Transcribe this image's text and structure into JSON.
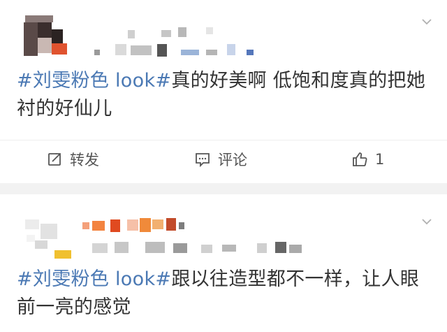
{
  "posts": [
    {
      "text_topic": "#刘雯粉色 look#",
      "text_body_line1": "真的好美啊 低饱和度真的把她",
      "text_body_line2": "衬的好仙儿",
      "actions": {
        "repost_label": "转发",
        "comment_label": "评论",
        "like_count": "1"
      }
    },
    {
      "text_topic": "#刘雯粉色 look#",
      "text_body_line1": "跟以往造型都不一样，让人眼",
      "text_body_line2": "前一亮的感觉"
    }
  ],
  "icons": {
    "chevron": "chevron-down-icon",
    "repost": "repost-icon",
    "comment": "comment-icon",
    "like": "thumbs-up-icon"
  },
  "colors": {
    "topic_link": "#4b79b4",
    "text": "#333333",
    "separator": "#f2f2f2"
  }
}
